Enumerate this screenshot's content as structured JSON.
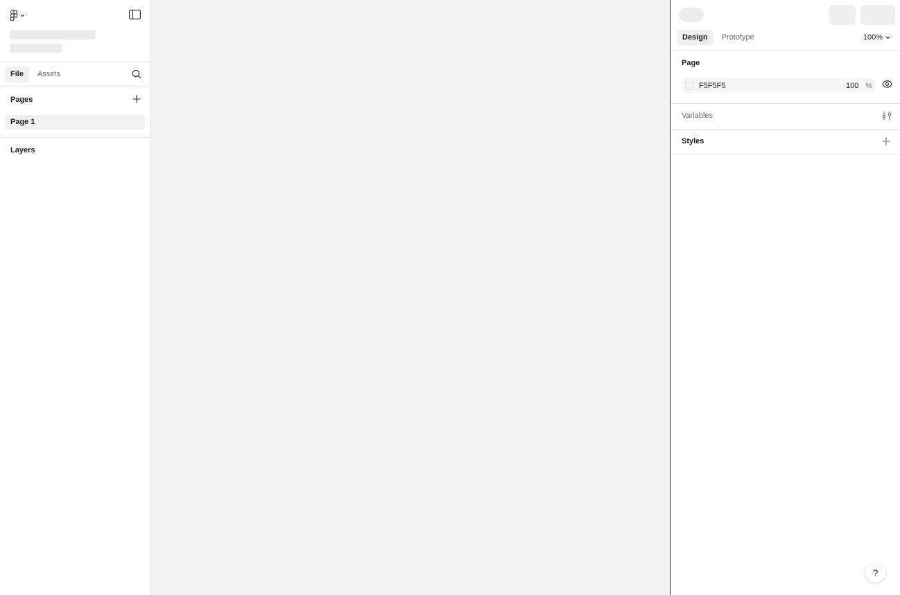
{
  "left_panel": {
    "tabs": [
      {
        "label": "File",
        "active": true
      },
      {
        "label": "Assets",
        "active": false
      }
    ],
    "pages_title": "Pages",
    "pages": [
      {
        "label": "Page 1",
        "selected": true
      }
    ],
    "layers_title": "Layers"
  },
  "right_panel": {
    "tabs": [
      {
        "label": "Design",
        "active": true
      },
      {
        "label": "Prototype",
        "active": false
      }
    ],
    "zoom": "100%",
    "page_section": {
      "title": "Page",
      "fill_hex": "F5F5F5",
      "opacity": "100",
      "opacity_unit": "%"
    },
    "variables_label": "Variables",
    "styles_label": "Styles",
    "help_label": "?"
  },
  "colors": {
    "canvas_bg": "#F2F2F2",
    "panel_bg": "#FFFFFF",
    "page_fill": "#F5F5F5"
  }
}
